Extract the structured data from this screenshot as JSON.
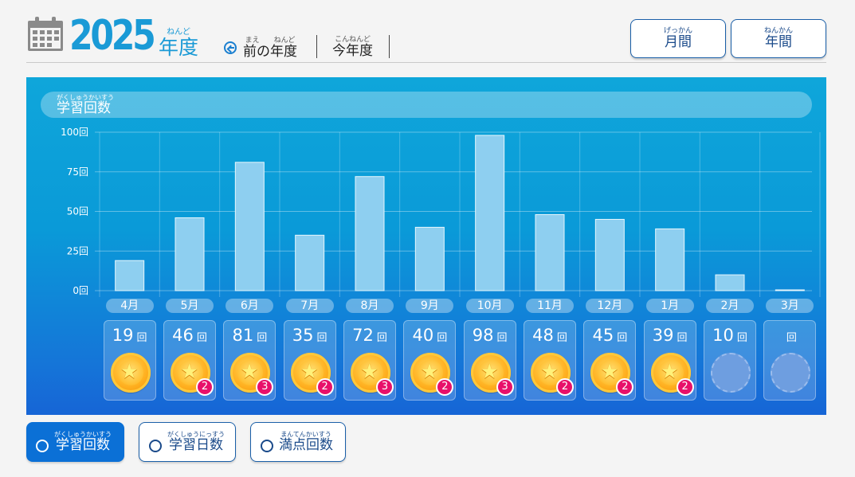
{
  "header": {
    "year": "2025",
    "year_suffix": "年度",
    "year_suffix_ruby": "ねんど",
    "prev_label": "前の年度",
    "prev_ruby": "まえ　　ねんど",
    "this_label": "今年度",
    "this_ruby": "こんねんど",
    "monthly_label": "月間",
    "monthly_ruby": "げっかん",
    "yearly_label": "年間",
    "yearly_ruby": "ねんかん"
  },
  "panel": {
    "title": "学習回数",
    "title_ruby": "がくしゅうかいすう"
  },
  "chart_data": {
    "type": "bar",
    "title": "学習回数",
    "categories": [
      "4月",
      "5月",
      "6月",
      "7月",
      "8月",
      "9月",
      "10月",
      "11月",
      "12月",
      "1月",
      "2月",
      "3月"
    ],
    "values": [
      19,
      46,
      81,
      35,
      72,
      40,
      98,
      48,
      45,
      39,
      10,
      0
    ],
    "ylim": [
      0,
      100
    ],
    "yticks": [
      "0回",
      "25回",
      "50回",
      "75回",
      "100回"
    ],
    "ytick_values": [
      0,
      25,
      50,
      75,
      100
    ],
    "grid": true,
    "colors": {
      "bar": "#8ecff0",
      "bar_border": "#e6f6fc"
    }
  },
  "cards": [
    {
      "count": "19",
      "unit": "回",
      "medal": true,
      "badge": ""
    },
    {
      "count": "46",
      "unit": "回",
      "medal": true,
      "badge": "2"
    },
    {
      "count": "81",
      "unit": "回",
      "medal": true,
      "badge": "3"
    },
    {
      "count": "35",
      "unit": "回",
      "medal": true,
      "badge": "2"
    },
    {
      "count": "72",
      "unit": "回",
      "medal": true,
      "badge": "3"
    },
    {
      "count": "40",
      "unit": "回",
      "medal": true,
      "badge": "2"
    },
    {
      "count": "98",
      "unit": "回",
      "medal": true,
      "badge": "3"
    },
    {
      "count": "48",
      "unit": "回",
      "medal": true,
      "badge": "2"
    },
    {
      "count": "45",
      "unit": "回",
      "medal": true,
      "badge": "2"
    },
    {
      "count": "39",
      "unit": "回",
      "medal": true,
      "badge": "2"
    },
    {
      "count": "10",
      "unit": "回",
      "medal": false,
      "badge": ""
    },
    {
      "count": "",
      "unit": "回",
      "medal": false,
      "badge": ""
    }
  ],
  "toggles": [
    {
      "label": "学習回数",
      "ruby": "がくしゅうかいすう",
      "selected": true
    },
    {
      "label": "学習日数",
      "ruby": "がくしゅうにっすう",
      "selected": false
    },
    {
      "label": "満点回数",
      "ruby": "まんてんかいすう",
      "selected": false
    }
  ],
  "icons": {
    "calendar": "calendar-icon",
    "prev": "circle-arrow-left-icon",
    "medal": "star-medal-icon"
  }
}
